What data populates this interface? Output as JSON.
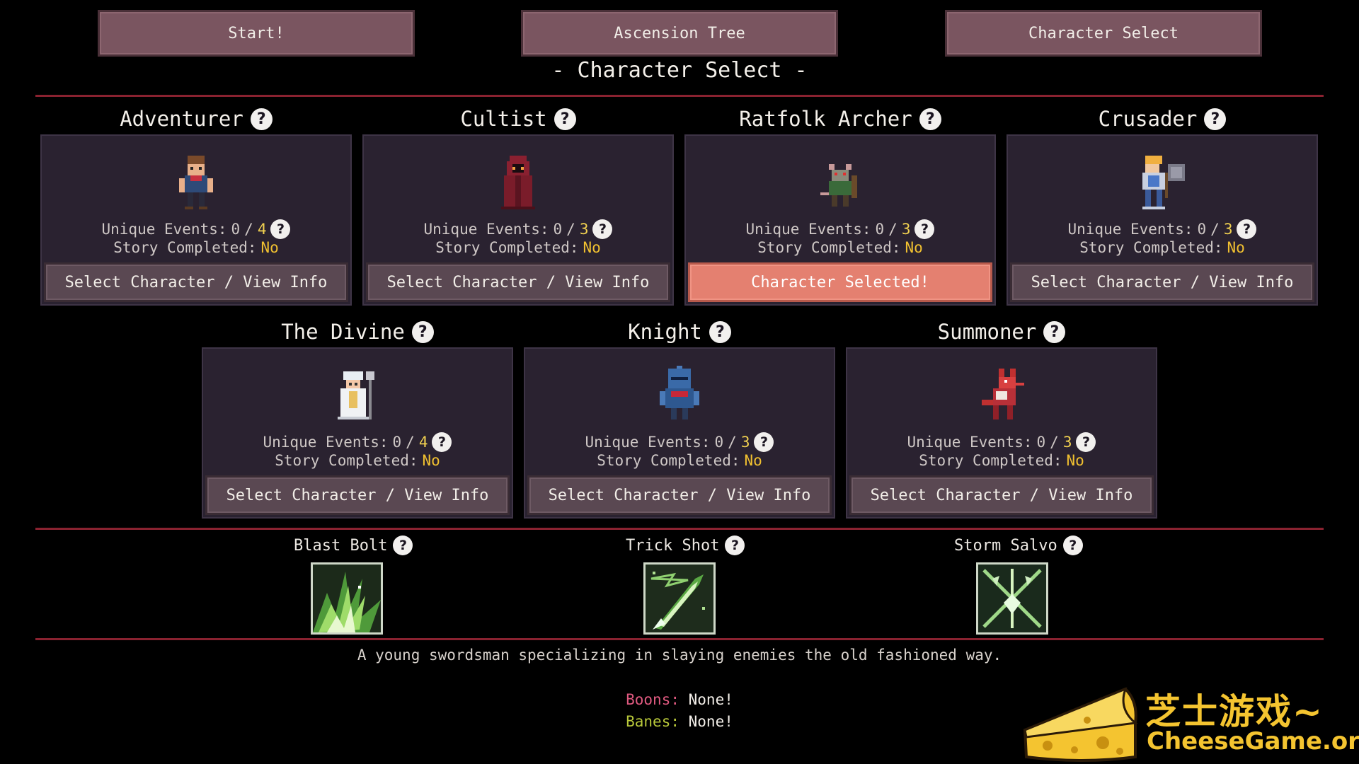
{
  "top_buttons": {
    "start": "Start!",
    "ascension": "Ascension Tree",
    "character_select": "Character Select"
  },
  "screen_title": "- Character Select -",
  "help_glyph": "?",
  "characters": [
    {
      "name": "Adventurer",
      "events_label": "Unique Events:",
      "events_done": "0",
      "sep": "/",
      "events_total": "4",
      "story_label": "Story Completed:",
      "story_value": "No",
      "button": "Select Character / View Info",
      "selected": false,
      "sprite": "adventurer-sprite"
    },
    {
      "name": "Cultist",
      "events_label": "Unique Events:",
      "events_done": "0",
      "sep": "/",
      "events_total": "3",
      "story_label": "Story Completed:",
      "story_value": "No",
      "button": "Select Character / View Info",
      "selected": false,
      "sprite": "cultist-sprite"
    },
    {
      "name": "Ratfolk Archer",
      "events_label": "Unique Events:",
      "events_done": "0",
      "sep": "/",
      "events_total": "3",
      "story_label": "Story Completed:",
      "story_value": "No",
      "button": "Character Selected!",
      "selected": true,
      "sprite": "ratfolk-archer-sprite"
    },
    {
      "name": "Crusader",
      "events_label": "Unique Events:",
      "events_done": "0",
      "sep": "/",
      "events_total": "3",
      "story_label": "Story Completed:",
      "story_value": "No",
      "button": "Select Character / View Info",
      "selected": false,
      "sprite": "crusader-sprite"
    },
    {
      "name": "The Divine",
      "events_label": "Unique Events:",
      "events_done": "0",
      "sep": "/",
      "events_total": "4",
      "story_label": "Story Completed:",
      "story_value": "No",
      "button": "Select Character / View Info",
      "selected": false,
      "sprite": "divine-sprite"
    },
    {
      "name": "Knight",
      "events_label": "Unique Events:",
      "events_done": "0",
      "sep": "/",
      "events_total": "3",
      "story_label": "Story Completed:",
      "story_value": "No",
      "button": "Select Character / View Info",
      "selected": false,
      "sprite": "knight-sprite"
    },
    {
      "name": "Summoner",
      "events_label": "Unique Events:",
      "events_done": "0",
      "sep": "/",
      "events_total": "3",
      "story_label": "Story Completed:",
      "story_value": "No",
      "button": "Select Character / View Info",
      "selected": false,
      "sprite": "summoner-sprite"
    }
  ],
  "skills": [
    {
      "name": "Blast Bolt",
      "icon": "blast-bolt-icon"
    },
    {
      "name": "Trick Shot",
      "icon": "trick-shot-icon"
    },
    {
      "name": "Storm Salvo",
      "icon": "storm-salvo-icon"
    }
  ],
  "description": "A young swordsman specializing in slaying enemies the old fashioned way.",
  "boons": {
    "label": "Boons:",
    "value": "None!"
  },
  "banes": {
    "label": "Banes:",
    "value": "None!"
  },
  "watermark": {
    "cn": "芝士游戏~",
    "en": "CheeseGame.org"
  },
  "colors": {
    "accent_line": "#8a2230",
    "selected_button": "#e48070",
    "button": "#5a4852",
    "highlight_number": "#f0d050",
    "boon": "#e05a80",
    "bane": "#b8c83a",
    "watermark": "#f4c430"
  }
}
